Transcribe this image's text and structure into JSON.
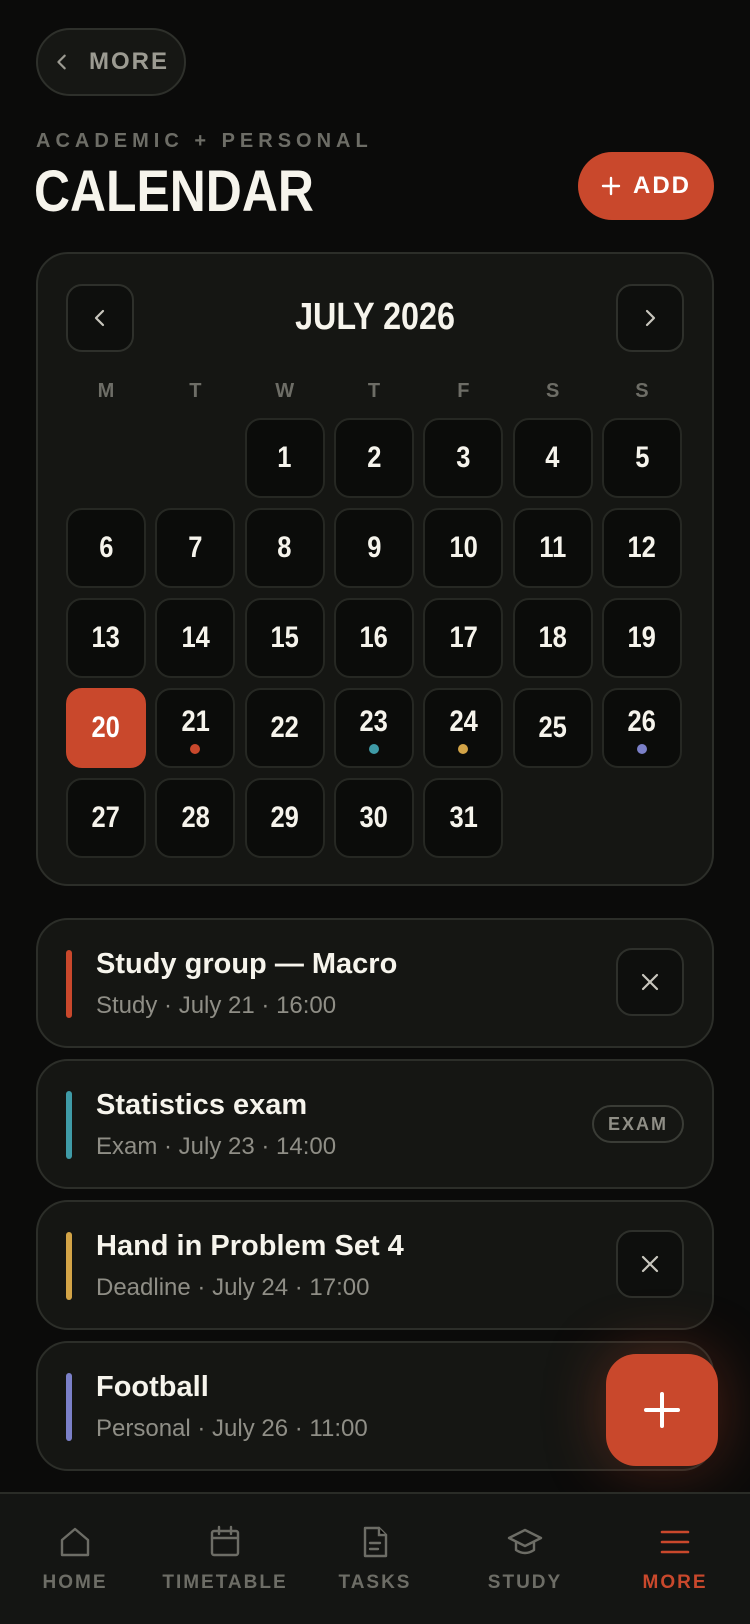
{
  "header": {
    "back_label": "MORE",
    "kicker": "ACADEMIC + PERSONAL",
    "title": "CALENDAR",
    "add_label": "ADD"
  },
  "calendar": {
    "month_label": "JULY 2026",
    "weekdays": [
      "M",
      "T",
      "W",
      "T",
      "F",
      "S",
      "S"
    ],
    "today": 20,
    "days": [
      {
        "label": ""
      },
      {
        "label": ""
      },
      {
        "label": "1"
      },
      {
        "label": "2"
      },
      {
        "label": "3"
      },
      {
        "label": "4"
      },
      {
        "label": "5"
      },
      {
        "label": "6"
      },
      {
        "label": "7"
      },
      {
        "label": "8"
      },
      {
        "label": "9"
      },
      {
        "label": "10"
      },
      {
        "label": "11"
      },
      {
        "label": "12"
      },
      {
        "label": "13"
      },
      {
        "label": "14"
      },
      {
        "label": "15"
      },
      {
        "label": "16"
      },
      {
        "label": "17"
      },
      {
        "label": "18"
      },
      {
        "label": "19"
      },
      {
        "label": "20",
        "today": true
      },
      {
        "label": "21",
        "dot": "#c9482c"
      },
      {
        "label": "22"
      },
      {
        "label": "23",
        "dot": "#3f9ba7"
      },
      {
        "label": "24",
        "dot": "#d3a447"
      },
      {
        "label": "25"
      },
      {
        "label": "26",
        "dot": "#7b80c8"
      },
      {
        "label": "27"
      },
      {
        "label": "28"
      },
      {
        "label": "29"
      },
      {
        "label": "30"
      },
      {
        "label": "31"
      }
    ]
  },
  "events": [
    {
      "title": "Study group — Macro",
      "meta": "Study · July 21 · 16:00",
      "color": "#c9482c",
      "action": "remove"
    },
    {
      "title": "Statistics exam",
      "meta": "Exam · July 23 · 14:00",
      "color": "#3f9ba7",
      "action": "badge",
      "badge": "EXAM"
    },
    {
      "title": "Hand in Problem Set 4",
      "meta": "Deadline · July 24 · 17:00",
      "color": "#d3a447",
      "action": "remove"
    },
    {
      "title": "Football",
      "meta": "Personal · July 26 · 11:00",
      "color": "#7b80c8",
      "action": "none"
    }
  ],
  "tabs": [
    {
      "label": "HOME",
      "icon": "home-icon"
    },
    {
      "label": "TIMETABLE",
      "icon": "calendar-icon"
    },
    {
      "label": "TASKS",
      "icon": "document-icon"
    },
    {
      "label": "STUDY",
      "icon": "graduation-cap-icon"
    },
    {
      "label": "MORE",
      "icon": "menu-icon",
      "active": true
    }
  ],
  "colors": {
    "accent": "#c9482c",
    "background": "#0b0b0a",
    "card": "#151613"
  }
}
